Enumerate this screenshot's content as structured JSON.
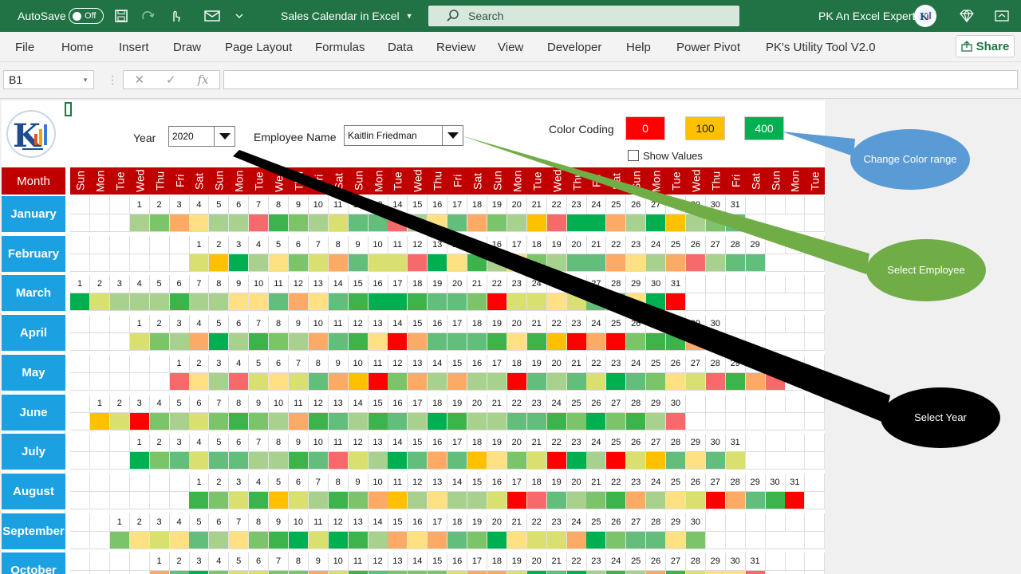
{
  "titlebar": {
    "autosave_label": "AutoSave",
    "autosave_state": "Off",
    "doc_title": "Sales Calendar in Excel",
    "search_placeholder": "Search",
    "user_name": "PK An Excel Expert"
  },
  "ribbon": {
    "tabs": [
      "File",
      "Home",
      "Insert",
      "Draw",
      "Page Layout",
      "Formulas",
      "Data",
      "Review",
      "View",
      "Developer",
      "Help",
      "Power Pivot",
      "PK's Utility Tool V2.0"
    ],
    "share_label": "Share"
  },
  "formula_bar": {
    "name_box": "B1",
    "fx_label": "fx",
    "formula": ""
  },
  "controls": {
    "year_label": "Year",
    "year_value": "2020",
    "employee_label": "Employee Name",
    "employee_value": "Kaitlin Friedman",
    "color_coding_label": "Color Coding",
    "color_low": "0",
    "color_mid": "100",
    "color_high": "400",
    "show_values_label": "Show Values"
  },
  "colors": {
    "low": "#ff0000",
    "mid": "#ffc000",
    "high": "#00b050",
    "header_red": "#c00000",
    "month_blue": "#1ba1e2",
    "excel_green": "#217346"
  },
  "calendar": {
    "month_header": "Month",
    "day_headers": [
      "Sun",
      "Mon",
      "Tue",
      "Wed",
      "Thu",
      "Fri",
      "Sat",
      "Sun",
      "Mon",
      "Tue",
      "Wed",
      "Thu",
      "Fri",
      "Sat",
      "Sun",
      "Mon",
      "Tue",
      "Wed",
      "Thu",
      "Fri",
      "Sat",
      "Sun",
      "Mon",
      "Tue",
      "Wed",
      "Thu",
      "Fri",
      "Sat",
      "Sun",
      "Mon",
      "Tue",
      "Wed",
      "Thu",
      "Fri",
      "Sat",
      "Sun",
      "Mon",
      "Tue"
    ],
    "months": [
      {
        "name": "January",
        "start": 3,
        "days": 31
      },
      {
        "name": "February",
        "start": 6,
        "days": 29
      },
      {
        "name": "March",
        "start": 0,
        "days": 31
      },
      {
        "name": "April",
        "start": 3,
        "days": 30
      },
      {
        "name": "May",
        "start": 5,
        "days": 31
      },
      {
        "name": "June",
        "start": 1,
        "days": 30
      },
      {
        "name": "July",
        "start": 3,
        "days": 31
      },
      {
        "name": "August",
        "start": 6,
        "days": 31
      },
      {
        "name": "September",
        "start": 2,
        "days": 30
      },
      {
        "name": "October",
        "start": 4,
        "days": 31
      }
    ]
  },
  "callouts": {
    "color_range": "Change Color range",
    "select_employee": "Select Employee",
    "select_year": "Select Year"
  }
}
